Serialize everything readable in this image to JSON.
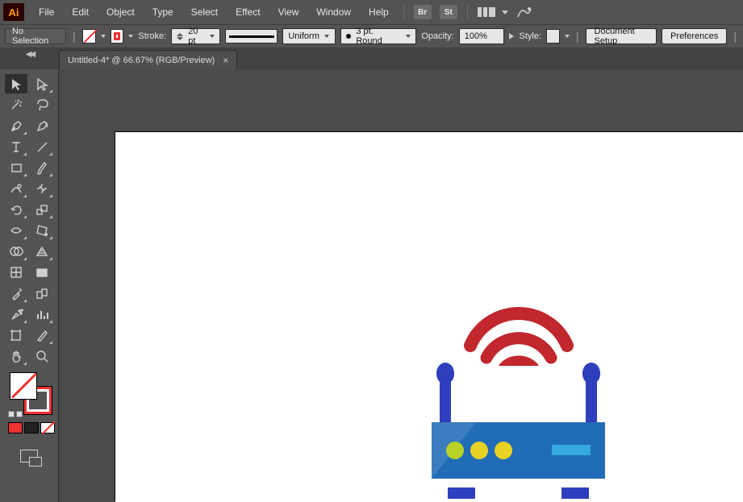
{
  "app": {
    "logo_text": "Ai"
  },
  "menu": {
    "items": [
      "File",
      "Edit",
      "Object",
      "Type",
      "Select",
      "Effect",
      "View",
      "Window",
      "Help"
    ],
    "br": "Br",
    "st": "St"
  },
  "control": {
    "no_selection": "No Selection",
    "stroke_label": "Stroke:",
    "stroke_value": "20 pt",
    "profile_label": "Uniform",
    "brush_label": "3 pt. Round",
    "opacity_label": "Opacity:",
    "opacity_value": "100%",
    "style_label": "Style:",
    "doc_setup": "Document Setup",
    "preferences": "Preferences"
  },
  "tab": {
    "title": "Untitled-4* @ 66.67% (RGB/Preview)",
    "close": "×"
  },
  "tools": {
    "names": [
      "selection-tool",
      "direct-selection-tool",
      "magic-wand-tool",
      "lasso-tool",
      "pen-tool",
      "curvature-tool",
      "type-tool",
      "line-segment-tool",
      "rectangle-tool",
      "paintbrush-tool",
      "shaper-tool",
      "eraser-tool",
      "rotate-tool",
      "scale-tool",
      "width-tool",
      "free-transform-tool",
      "shape-builder-tool",
      "perspective-grid-tool",
      "mesh-tool",
      "gradient-tool",
      "eyedropper-tool",
      "blend-tool",
      "symbol-sprayer-tool",
      "column-graph-tool",
      "artboard-tool",
      "slice-tool",
      "hand-tool",
      "zoom-tool"
    ]
  },
  "artwork": {
    "colors": {
      "router_body": "#206cb6",
      "router_dark": "#2e3fbe",
      "led_green": "#b7d327",
      "led_yellow": "#e8d324",
      "port_blue": "#36a9e1",
      "wifi_red": "#c1272d"
    }
  }
}
